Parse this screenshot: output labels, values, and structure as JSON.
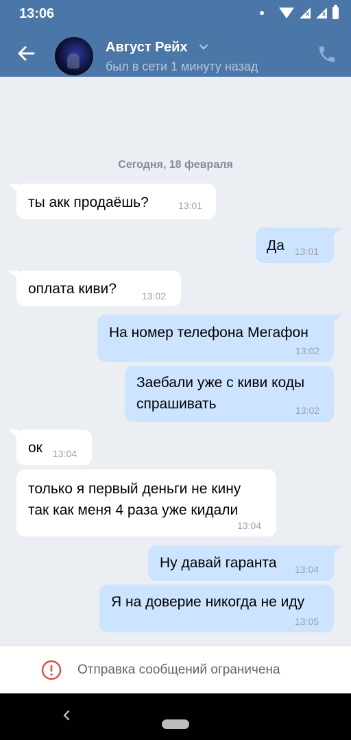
{
  "status_bar": {
    "time": "13:06"
  },
  "header": {
    "contact_name": "Август Рейх",
    "contact_status": "был в сети 1 минуту назад"
  },
  "chat": {
    "date_separator": "Сегодня, 18 февраля",
    "messages": [
      {
        "direction": "in",
        "lines": [
          "ты акк продаёшь?"
        ],
        "time": "13:01"
      },
      {
        "direction": "out",
        "lines": [
          "Да"
        ],
        "time": "13:01"
      },
      {
        "direction": "in",
        "lines": [
          "оплата киви?"
        ],
        "time": "13:02"
      },
      {
        "direction": "out",
        "lines": [
          "На номер телефона Мегафон"
        ],
        "time": "13:02"
      },
      {
        "direction": "out",
        "lines": [
          "Заебали уже с киви коды",
          "спрашивать"
        ],
        "time": "13:02"
      },
      {
        "direction": "in",
        "lines": [
          "ок"
        ],
        "time": "13:04"
      },
      {
        "direction": "in",
        "lines": [
          "только я первый деньги не кину",
          "так как меня 4 раза уже кидали"
        ],
        "time": "13:04"
      },
      {
        "direction": "out",
        "lines": [
          "Ну давай гаранта"
        ],
        "time": "13:04"
      },
      {
        "direction": "out",
        "lines": [
          "Я на доверие никогда не иду"
        ],
        "time": "13:05"
      }
    ]
  },
  "footer": {
    "restriction_notice": "Отправка сообщений ограничена"
  },
  "icons": {
    "back": "arrow-left-icon",
    "call": "phone-icon",
    "warning": "exclamation-circle-icon",
    "nav_back": "chevron-left-icon"
  },
  "colors": {
    "header": "#4a76a8",
    "chat_background": "#ebeef2",
    "incoming_bubble": "#ffffff",
    "outgoing_bubble": "#cce4ff",
    "warning": "#e64646"
  }
}
